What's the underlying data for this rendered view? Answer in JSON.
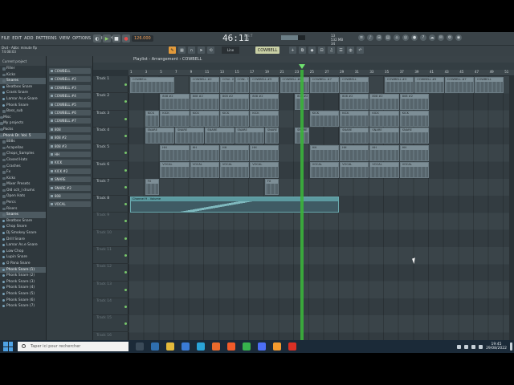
{
  "menu": [
    "FILE",
    "EDIT",
    "ADD",
    "PATTERNS",
    "VIEW",
    "OPTIONS",
    "TOOLS",
    "HELP"
  ],
  "transport": {
    "tempo": "126.000",
    "time": "46:11",
    "time_sub": "2:1",
    "time_label": "B:S:T"
  },
  "cpu": {
    "mem": "13",
    "mb": "532 MB",
    "voices": "34"
  },
  "hint": {
    "line1": "Dvd - Abbr. minute flp",
    "line2": "74:08:03"
  },
  "toolbar2": {
    "snap": "Line",
    "pattern": "COWBELL"
  },
  "playlist": {
    "title": "Playlist - Arrangement › COWBELL"
  },
  "ruler": [
    "1",
    "3",
    "5",
    "7",
    "9",
    "11",
    "13",
    "15",
    "17",
    "19",
    "21",
    "23",
    "25",
    "27",
    "29",
    "31",
    "33",
    "35",
    "37",
    "39",
    "41",
    "43",
    "45",
    "47",
    "49",
    "51"
  ],
  "browser": {
    "header": "Current project",
    "items": [
      {
        "label": "Filler",
        "level": 1,
        "type": "folder"
      },
      {
        "label": "Kicks",
        "level": 1,
        "type": "folder"
      },
      {
        "label": "Snares",
        "level": 1,
        "type": "folder",
        "selected": true
      },
      {
        "label": "Beatbox Snare",
        "level": 1,
        "type": "audio"
      },
      {
        "label": "Crank Snare",
        "level": 1,
        "type": "audio"
      },
      {
        "label": "Lamar As.e Snare",
        "level": 1,
        "type": "audio"
      },
      {
        "label": "Phonk Snare",
        "level": 1,
        "type": "audio"
      },
      {
        "label": "Bass_sub",
        "level": 1,
        "type": "folder"
      },
      {
        "label": "Misc",
        "level": 0,
        "type": "folder"
      },
      {
        "label": "My projects",
        "level": 0,
        "type": "folder"
      },
      {
        "label": "Packs",
        "level": 0,
        "type": "folder"
      },
      {
        "label": "Phonk Dr. Vol. 5",
        "level": 0,
        "type": "folder",
        "selected": true
      },
      {
        "label": "808s",
        "level": 1,
        "type": "folder"
      },
      {
        "label": "Acapellas",
        "level": 1,
        "type": "folder"
      },
      {
        "label": "Chops_Samples",
        "level": 1,
        "type": "folder"
      },
      {
        "label": "Closed Hats",
        "level": 1,
        "type": "folder"
      },
      {
        "label": "Crashes",
        "level": 1,
        "type": "folder"
      },
      {
        "label": "Fx",
        "level": 1,
        "type": "folder"
      },
      {
        "label": "Kicks",
        "level": 1,
        "type": "folder"
      },
      {
        "label": "Mixer Presets",
        "level": 1,
        "type": "folder"
      },
      {
        "label": "Old sch_l drums",
        "level": 1,
        "type": "folder"
      },
      {
        "label": "Open Hats",
        "level": 1,
        "type": "folder"
      },
      {
        "label": "Percs",
        "level": 1,
        "type": "folder"
      },
      {
        "label": "Risers",
        "level": 1,
        "type": "folder"
      },
      {
        "label": "Snares",
        "level": 1,
        "type": "folder",
        "selected": true
      },
      {
        "label": "Beatbox Snare",
        "level": 1,
        "type": "audio"
      },
      {
        "label": "Chop Snare",
        "level": 1,
        "type": "audio"
      },
      {
        "label": "Dj Smokey Snare",
        "level": 1,
        "type": "audio"
      },
      {
        "label": "Drill Snare",
        "level": 1,
        "type": "audio"
      },
      {
        "label": "Lamar As.e Snare",
        "level": 1,
        "type": "audio"
      },
      {
        "label": "Low Chop",
        "level": 1,
        "type": "audio"
      },
      {
        "label": "Lupin Snare",
        "level": 1,
        "type": "audio"
      },
      {
        "label": "O Pana Snare",
        "level": 1,
        "type": "audio"
      },
      {
        "label": "Phonk Snare (1)",
        "level": 1,
        "type": "audio",
        "selected": true
      },
      {
        "label": "Phonk Snare (2)",
        "level": 1,
        "type": "audio"
      },
      {
        "label": "Phonk Snare (3)",
        "level": 1,
        "type": "audio"
      },
      {
        "label": "Phonk Snare (4)",
        "level": 1,
        "type": "audio"
      },
      {
        "label": "Phonk Snare (5)",
        "level": 1,
        "type": "audio"
      },
      {
        "label": "Phonk Snare (6)",
        "level": 1,
        "type": "audio"
      },
      {
        "label": "Phonk Snare (7)",
        "level": 1,
        "type": "audio"
      }
    ]
  },
  "channels": [
    "COWBELL",
    "COWBELL #2",
    "COWBELL #3",
    "COWBELL #4",
    "COWBELL #5",
    "COWBELL #6",
    "COWBELL #7",
    "808",
    "808 #2",
    "808 #3",
    "HH",
    "KICK",
    "KICK #2",
    "SNARE",
    "SNARE #2",
    "808",
    "VOCAL"
  ],
  "tracks": [
    "Track 1",
    "Track 2",
    "Track 3",
    "Track 4",
    "Track 5",
    "Track 6",
    "Track 7",
    "Track 8",
    "Track 9",
    "Track 10",
    "Track 11",
    "Track 12",
    "Track 13",
    "Track 14",
    "Track 15",
    "Track 16"
  ],
  "clips": [
    {
      "track": 0,
      "start": 0,
      "len": 3,
      "label": "COWBELL"
    },
    {
      "track": 0,
      "start": 4,
      "len": 2,
      "label": "COWBELL #2"
    },
    {
      "track": 0,
      "start": 6,
      "len": 1,
      "label": "COW.. 2"
    },
    {
      "track": 0,
      "start": 7,
      "len": 1,
      "label": "COW.. 3"
    },
    {
      "track": 0,
      "start": 8,
      "len": 2,
      "label": "COWBELL #5"
    },
    {
      "track": 0,
      "start": 10,
      "len": 2,
      "label": "COWBELL #6"
    },
    {
      "track": 0,
      "start": 12,
      "len": 2,
      "label": "COWBELL #7"
    },
    {
      "track": 0,
      "start": 14,
      "len": 2,
      "label": "COWBELL"
    },
    {
      "track": 0,
      "start": 17,
      "len": 2,
      "label": "COWBELL #3"
    },
    {
      "track": 0,
      "start": 19,
      "len": 2,
      "label": "COWBELL #5"
    },
    {
      "track": 0,
      "start": 21,
      "len": 2,
      "label": "COWBELL #7"
    },
    {
      "track": 0,
      "start": 23,
      "len": 2,
      "label": "COWBELL"
    },
    {
      "track": 1,
      "start": 2,
      "len": 2,
      "label": "808 #2"
    },
    {
      "track": 1,
      "start": 4,
      "len": 2,
      "label": "808 #2"
    },
    {
      "track": 1,
      "start": 6,
      "len": 2,
      "label": "808 #2"
    },
    {
      "track": 1,
      "start": 8,
      "len": 2,
      "label": "808 #2"
    },
    {
      "track": 1,
      "start": 11,
      "len": 1,
      "label": "808 #2"
    },
    {
      "track": 1,
      "start": 14,
      "len": 2,
      "label": "808 #2"
    },
    {
      "track": 1,
      "start": 16,
      "len": 2,
      "label": "808 #2"
    },
    {
      "track": 1,
      "start": 18,
      "len": 2,
      "label": "808 #2"
    },
    {
      "track": 2,
      "start": 1,
      "len": 1,
      "label": "KICK"
    },
    {
      "track": 2,
      "start": 2,
      "len": 2,
      "label": "KICK"
    },
    {
      "track": 2,
      "start": 4,
      "len": 2,
      "label": "KICK"
    },
    {
      "track": 2,
      "start": 6,
      "len": 2,
      "label": "KICK"
    },
    {
      "track": 2,
      "start": 8,
      "len": 2,
      "label": "KICK"
    },
    {
      "track": 2,
      "start": 12,
      "len": 2,
      "label": "KICK"
    },
    {
      "track": 2,
      "start": 14,
      "len": 2,
      "label": "KICK"
    },
    {
      "track": 2,
      "start": 16,
      "len": 2,
      "label": "KICK"
    },
    {
      "track": 2,
      "start": 18,
      "len": 2,
      "label": "KICK"
    },
    {
      "track": 3,
      "start": 1,
      "len": 2,
      "label": "SNARE"
    },
    {
      "track": 3,
      "start": 3,
      "len": 2,
      "label": "SNARE"
    },
    {
      "track": 3,
      "start": 5,
      "len": 2,
      "label": "SNARE"
    },
    {
      "track": 3,
      "start": 7,
      "len": 2,
      "label": "SNARE"
    },
    {
      "track": 3,
      "start": 9,
      "len": 1,
      "label": "SNARE"
    },
    {
      "track": 3,
      "start": 11,
      "len": 1,
      "label": "SNARE"
    },
    {
      "track": 3,
      "start": 14,
      "len": 2,
      "label": "SNARE"
    },
    {
      "track": 3,
      "start": 16,
      "len": 2,
      "label": "SNARE"
    },
    {
      "track": 3,
      "start": 18,
      "len": 2,
      "label": "SNARE"
    },
    {
      "track": 4,
      "start": 2,
      "len": 2,
      "label": "HH"
    },
    {
      "track": 4,
      "start": 4,
      "len": 2,
      "label": "HH"
    },
    {
      "track": 4,
      "start": 6,
      "len": 2,
      "label": "HH"
    },
    {
      "track": 4,
      "start": 8,
      "len": 2,
      "label": "HH"
    },
    {
      "track": 4,
      "start": 12,
      "len": 2,
      "label": "HH"
    },
    {
      "track": 4,
      "start": 14,
      "len": 2,
      "label": "HH"
    },
    {
      "track": 4,
      "start": 16,
      "len": 2,
      "label": "HH"
    },
    {
      "track": 4,
      "start": 18,
      "len": 2,
      "label": "HH"
    },
    {
      "track": 5,
      "start": 2,
      "len": 2,
      "label": "VOCAL"
    },
    {
      "track": 5,
      "start": 4,
      "len": 2,
      "label": "VOCAL"
    },
    {
      "track": 5,
      "start": 6,
      "len": 2,
      "label": "VOCAL"
    },
    {
      "track": 5,
      "start": 8,
      "len": 2,
      "label": "VOCAL"
    },
    {
      "track": 5,
      "start": 12,
      "len": 2,
      "label": "VOCAL"
    },
    {
      "track": 5,
      "start": 14,
      "len": 2,
      "label": "VOCAL"
    },
    {
      "track": 5,
      "start": 16,
      "len": 2,
      "label": "VOCAL"
    },
    {
      "track": 5,
      "start": 18,
      "len": 2,
      "label": "VOCAL"
    },
    {
      "track": 6,
      "start": 1,
      "len": 1,
      "label": "FX"
    },
    {
      "track": 6,
      "start": 9,
      "len": 1,
      "label": "FX"
    },
    {
      "track": 7,
      "start": 0,
      "len": 14,
      "label": "Channel 9 - Volume",
      "auto": true
    }
  ],
  "taskbar": {
    "search_placeholder": "Taper ici pour rechercher",
    "time": "19:45",
    "date": "29/08/2022"
  },
  "colors": {
    "accent": "#e39a3a",
    "playhead": "#3bb33b",
    "automation": "#5c9aa0"
  }
}
